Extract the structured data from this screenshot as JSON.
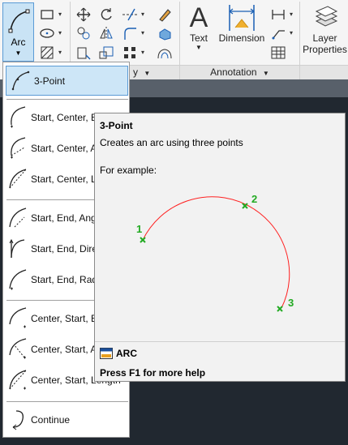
{
  "ribbon": {
    "arc_button": {
      "label": "Arc"
    },
    "modify_panel_fragment": "y",
    "annotation": {
      "text_label": "Text",
      "dimension_label": "Dimension",
      "panel_label": "Annotation"
    },
    "layers": {
      "properties_label_line1": "Layer",
      "properties_label_line2": "Properties"
    }
  },
  "arc_menu": {
    "items": [
      {
        "label": "3-Point",
        "icon": "arc-3point-icon",
        "active": true
      },
      {
        "label": "Start, Center, End",
        "icon": "arc-start-center-end-icon"
      },
      {
        "label": "Start, Center, Angle",
        "icon": "arc-start-center-angle-icon"
      },
      {
        "label": "Start, Center, Length",
        "icon": "arc-start-center-length-icon"
      },
      {
        "label": "Start, End, Angle",
        "icon": "arc-start-end-angle-icon"
      },
      {
        "label": "Start, End, Direction",
        "icon": "arc-start-end-direction-icon"
      },
      {
        "label": "Start, End, Radius",
        "icon": "arc-start-end-radius-icon"
      },
      {
        "label": "Center, Start, End",
        "icon": "arc-center-start-end-icon"
      },
      {
        "label": "Center, Start, Angle",
        "icon": "arc-center-start-angle-icon"
      },
      {
        "label": "Center, Start, Length",
        "icon": "arc-center-start-length-icon"
      },
      {
        "label": "Continue",
        "icon": "arc-continue-icon"
      }
    ]
  },
  "tooltip": {
    "title": "3-Point",
    "description": "Creates an arc using three points",
    "example_label": "For example:",
    "points": [
      "1",
      "2",
      "3"
    ],
    "command": "ARC",
    "help": "Press F1 for more help",
    "colors": {
      "arc": "#ff2020",
      "point": "#22aa22"
    }
  }
}
